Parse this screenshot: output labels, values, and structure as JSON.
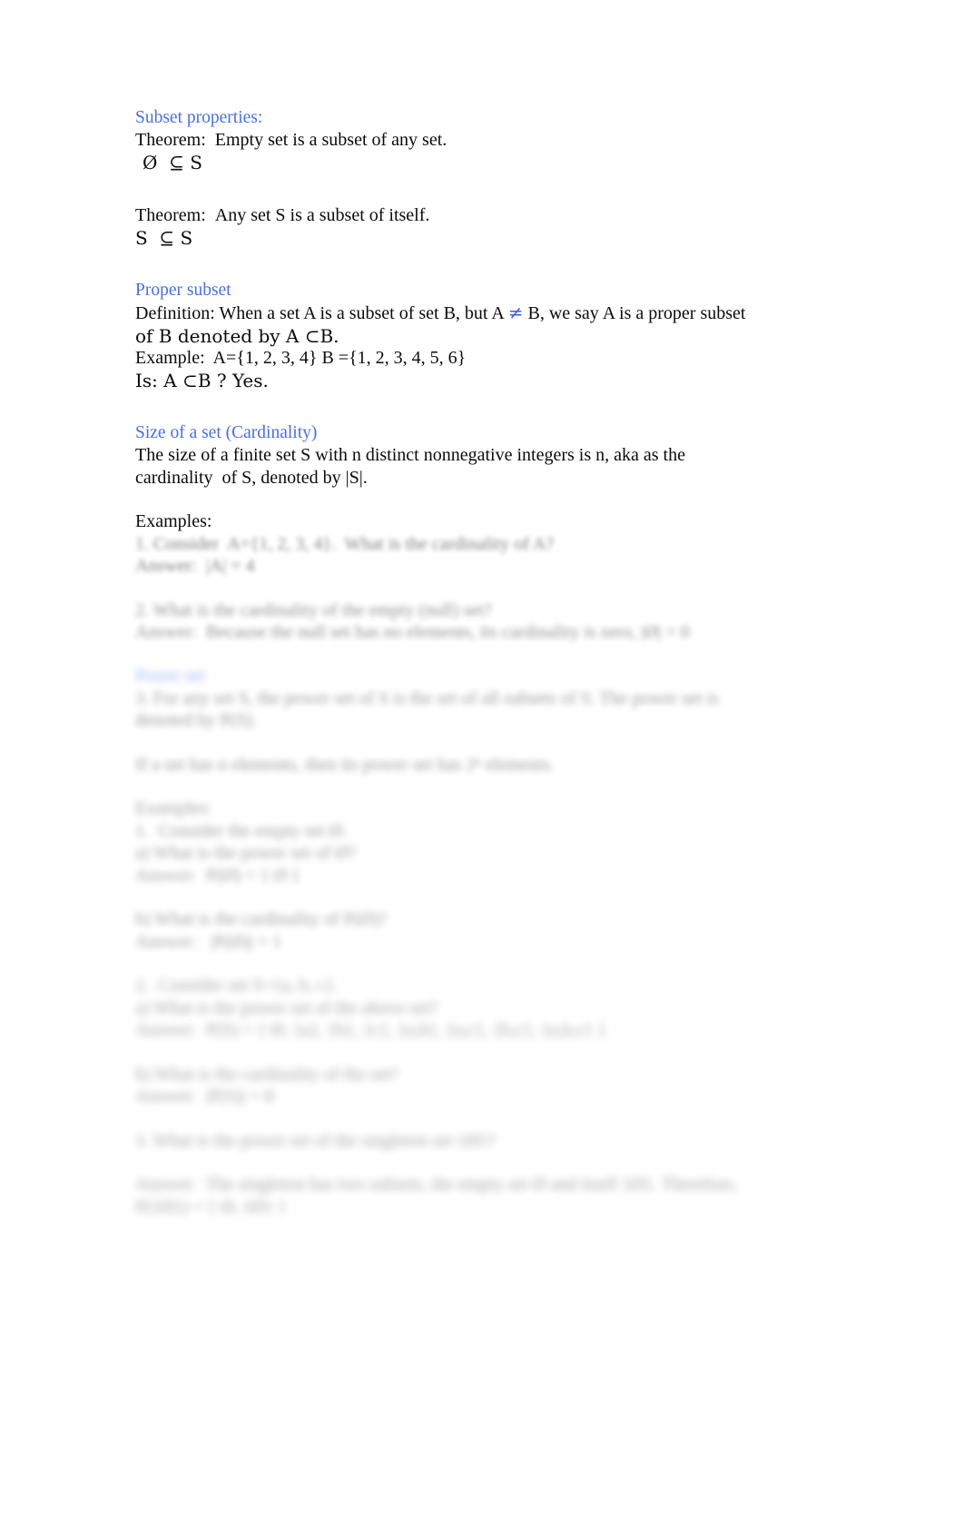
{
  "document": {
    "page_background": "#ffffff",
    "heading_color": "#4a6fe0",
    "body_color": "#0b0b0b",
    "sections": {
      "subset_properties": {
        "heading": "Subset properties:",
        "theorem_1_label": "Theorem:",
        "theorem_1_text": "Empty set is a subset of any set.",
        "theorem_1_formula": "Ø  ⊆ S",
        "theorem_2_label": "Theorem:",
        "theorem_2_text": "Any set S is a subset of itself.",
        "theorem_2_formula": "S  ⊆ S"
      },
      "proper_subset": {
        "heading": "Proper subset",
        "definition_line_1_a": "Definition:  When a set A is a subset of set B, but A ",
        "definition_neq_symbol": "≠",
        "definition_line_1_b": " B, we say A is a proper subset",
        "definition_line_2": "of B denoted by A ⊂B.",
        "example_line": "Example:  A={1, 2, 3, 4} B ={1, 2, 3, 4, 5, 6}",
        "question_line": "Is: A ⊂B ? Yes."
      },
      "cardinality": {
        "heading": "Size of a set (Cardinality)",
        "body_line_1": "The size of a finite set S with n distinct nonnegative integers is n, aka as the",
        "body_line_2": "cardinality  of S, denoted by |S|.",
        "examples_label": "Examples:"
      },
      "redacted": {
        "note": "blurred",
        "blurred_lines": [
          "1. Consider  A={1, 2, 3, 4}.  What is the cardinality of A?",
          "Answer:  |A| = 4",
          "2. What is the cardinality of the empty (null) set?",
          "Answer:  Because the null set has no elements, its cardinality is zero, |Ø| = 0",
          "3. For any set S, the power set of S is the set of all subsets of S. The power set is denoted by P(S).",
          "If a set has n elements, then its power set has 2ⁿ elements.",
          "Examples:",
          "1.  Consider the empty set Ø.",
          "a) What is the power set of Ø?",
          "Answer:  P(Ø) = { Ø }",
          "b) What is the cardinality of P(Ø)?",
          "Answer:   |P(Ø)| = 1",
          "2.  Consider set S={a, b, c}.",
          "a) What is the power set of the above set?",
          "Answer:  P(S) = { Ø, {a}, {b}, {c}, {a,b}, {a,c}, {b,c}, {a,b,c} }",
          "b) What is the cardinality of the set?",
          "Answer:  |P(S)| = 8",
          "3. What is the power set of the singleton set {Ø}?",
          "Answer:  The singleton has two subsets, the empty set Ø and itself {Ø}. Therefore,",
          "P({Ø}) = { Ø, {Ø} }"
        ],
        "blurred_heading": "Power set"
      }
    }
  }
}
